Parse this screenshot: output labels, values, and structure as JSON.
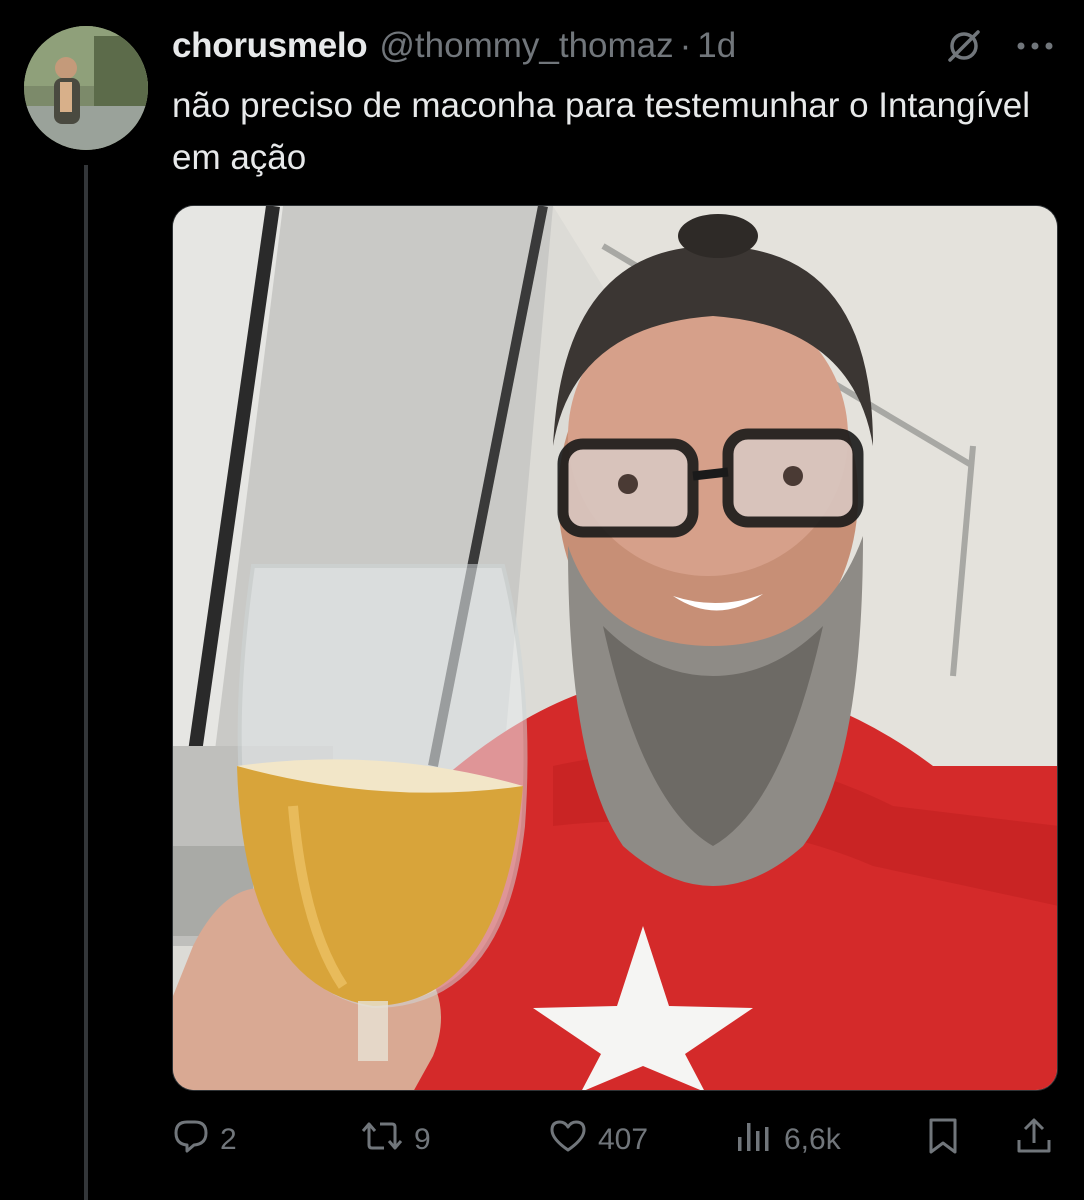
{
  "tweet": {
    "display_name": "chorusmelo",
    "handle": "@thommy_thomaz",
    "separator": "·",
    "time": "1d",
    "text": "não preciso de maconha para testemunhar o Intangível em ação",
    "media_alt": "Selfie de homem barbudo de óculos e camiseta vermelha com estrela branca, erguendo uma taça de cerveja"
  },
  "icons": {
    "grok": "grok-slash-icon",
    "more": "more-horizontal-icon",
    "reply": "reply-bubble-icon",
    "retweet": "retweet-icon",
    "like": "heart-icon",
    "views": "views-bar-icon",
    "bookmark": "bookmark-icon",
    "share": "share-icon"
  },
  "actions": {
    "replies": "2",
    "retweets": "9",
    "likes": "407",
    "views": "6,6k"
  },
  "colors": {
    "background": "#000000",
    "text_primary": "#e7e9ea",
    "text_secondary": "#71767b",
    "thread_line": "#333639",
    "shirt_red": "#d42a2a"
  }
}
